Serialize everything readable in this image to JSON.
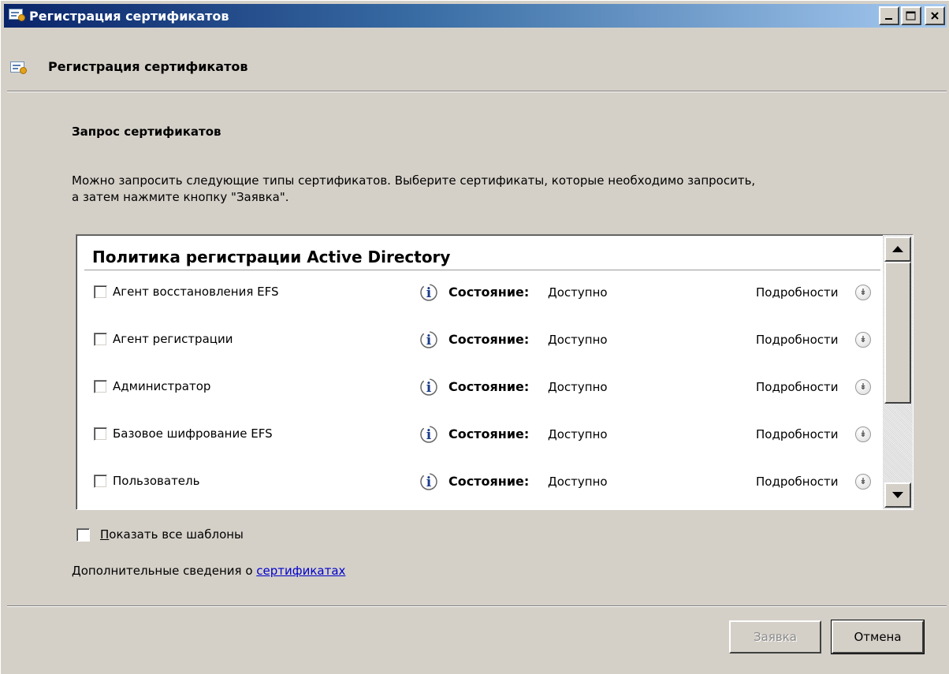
{
  "window": {
    "title": "Регистрация сертификатов",
    "minimize_glyph": "_",
    "maximize_glyph": "□",
    "close_glyph": "×"
  },
  "header": {
    "title": "Регистрация сертификатов"
  },
  "content": {
    "section_title": "Запрос сертификатов",
    "description_line1": "Можно запросить следующие типы сертификатов. Выберите сертификаты, которые необходимо запросить,",
    "description_line2": "а затем нажмите кнопку \"Заявка\"."
  },
  "policy": {
    "group_title": "Политика регистрации Active Directory",
    "state_label": "Состояние:",
    "details_label": "Подробности",
    "items": [
      {
        "name": "Агент восстановления EFS",
        "checked": false,
        "state": "Доступно"
      },
      {
        "name": "Агент регистрации",
        "checked": false,
        "state": "Доступно"
      },
      {
        "name": "Администратор",
        "checked": false,
        "state": "Доступно"
      },
      {
        "name": "Базовое шифрование EFS",
        "checked": false,
        "state": "Доступно"
      },
      {
        "name": "Пользователь",
        "checked": false,
        "state": "Доступно"
      }
    ]
  },
  "options": {
    "show_all_label": "Показать все шаблоны",
    "more_info_prefix": "Дополнительные сведения о ",
    "more_info_link": "сертификатах"
  },
  "buttons": {
    "enroll": "Заявка",
    "enroll_enabled": false,
    "cancel": "Отмена"
  },
  "colors": {
    "titlebar_start": "#0a246a",
    "titlebar_end": "#a6caf0",
    "face": "#d4d0c8",
    "link": "#0000cc"
  }
}
